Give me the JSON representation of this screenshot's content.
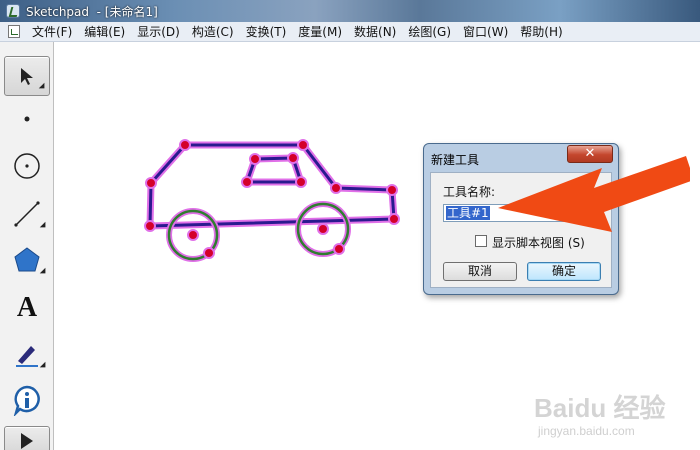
{
  "window": {
    "app_name": "Sketchpad",
    "title": "Sketchpad  - [未命名1]"
  },
  "menu": {
    "items": [
      "文件(F)",
      "编辑(E)",
      "显示(D)",
      "构造(C)",
      "变换(T)",
      "度量(M)",
      "数据(N)",
      "绘图(G)",
      "窗口(W)",
      "帮助(H)"
    ]
  },
  "toolbar": {
    "tools": [
      {
        "name": "arrow-tool-icon",
        "glyph": "➤",
        "selected": true
      },
      {
        "name": "point-tool-icon",
        "glyph": "•"
      },
      {
        "name": "compass-tool-icon",
        "glyph": "⊕"
      },
      {
        "name": "straightedge-tool-icon",
        "glyph": "╱"
      },
      {
        "name": "polygon-tool-icon",
        "glyph": "⬟"
      },
      {
        "name": "text-tool-icon",
        "glyph": "A"
      },
      {
        "name": "marker-tool-icon",
        "glyph": "✎"
      },
      {
        "name": "information-tool-icon",
        "glyph": "i"
      },
      {
        "name": "custom-tool-icon",
        "glyph": "▶"
      }
    ]
  },
  "dialog": {
    "title": "新建工具",
    "close_label": "✕",
    "name_label": "工具名称:",
    "name_value": "工具#1",
    "checkbox_label": "显示脚本视图 (S)",
    "checkbox_checked": false,
    "cancel_label": "取消",
    "ok_label": "确定"
  },
  "annotation": {
    "arrow_color": "#f04a14"
  },
  "watermark": {
    "brand": "Baidu 经验",
    "url": "jingyan.baidu.com"
  },
  "colors": {
    "segment": "#2a1a8f",
    "highlight": "#e070e8",
    "point": "#d4002a",
    "circle": "#2f7d2f"
  }
}
